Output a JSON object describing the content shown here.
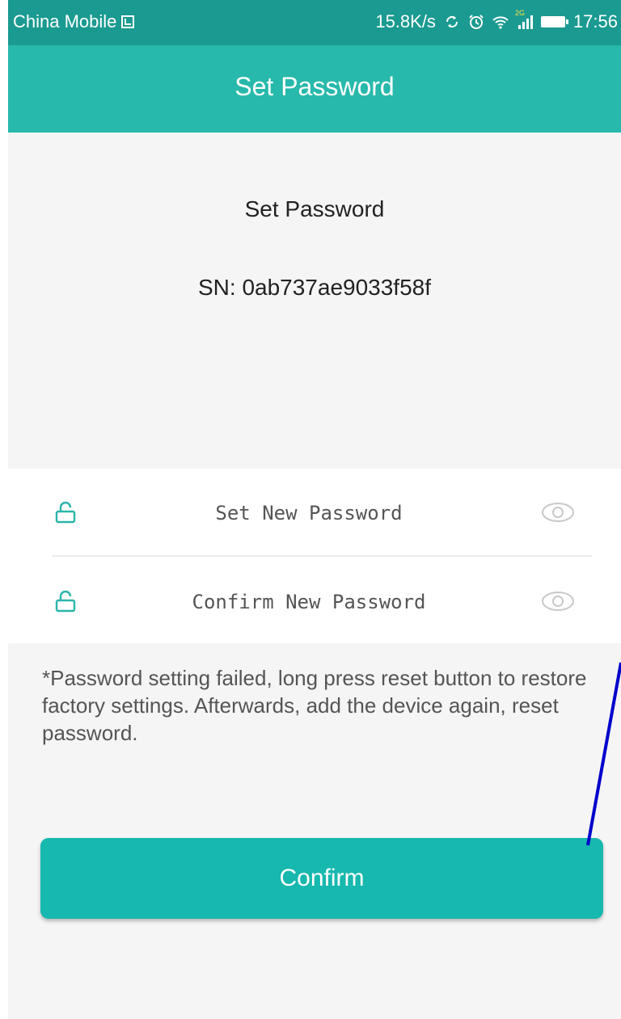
{
  "status_bar": {
    "carrier": "China Mobile",
    "network_speed": "15.8K/s",
    "signal_tag": "2G",
    "time": "17:56"
  },
  "app_bar": {
    "title": "Set Password"
  },
  "header": {
    "heading": "Set Password",
    "serial": "SN: 0ab737ae9033f58f"
  },
  "form": {
    "new_password_placeholder": "Set New Password",
    "new_password_value": "",
    "confirm_password_placeholder": "Confirm New Password",
    "confirm_password_value": ""
  },
  "note": "*Password setting failed, long press reset button to restore factory settings. Afterwards, add the device again, reset password.",
  "confirm_button_label": "Confirm",
  "colors": {
    "status_bar": "#1a9a90",
    "app_bar": "#27b9ab",
    "accent": "#17b8ae",
    "icon_teal": "#2bb5ab",
    "annotation_line": "#0000cc"
  },
  "icons": {
    "lock": "lock-icon",
    "eye": "eye-icon"
  }
}
